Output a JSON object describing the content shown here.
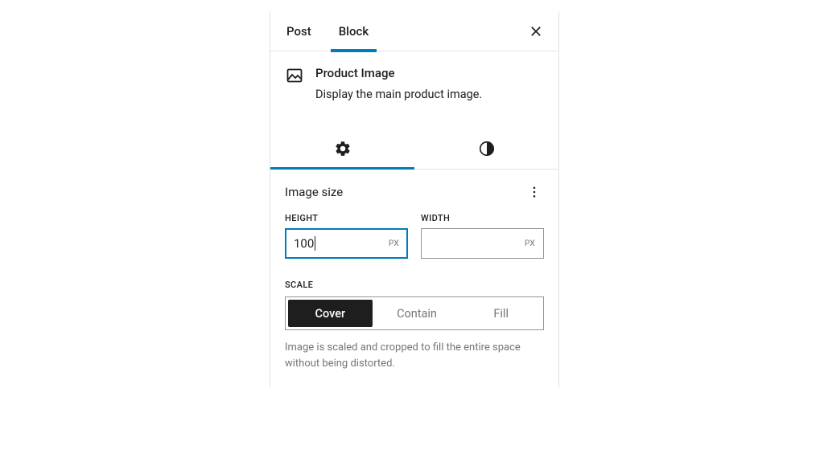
{
  "tabs": {
    "post": "Post",
    "block": "Block"
  },
  "block_card": {
    "title": "Product Image",
    "description": "Display the main product image."
  },
  "section": {
    "title": "Image size"
  },
  "fields": {
    "height": {
      "label": "HEIGHT",
      "value": "100",
      "unit": "PX"
    },
    "width": {
      "label": "WIDTH",
      "value": "",
      "unit": "PX"
    }
  },
  "scale": {
    "label": "SCALE",
    "options": {
      "cover": "Cover",
      "contain": "Contain",
      "fill": "Fill"
    },
    "help": "Image is scaled and cropped to fill the entire space without being distorted."
  }
}
